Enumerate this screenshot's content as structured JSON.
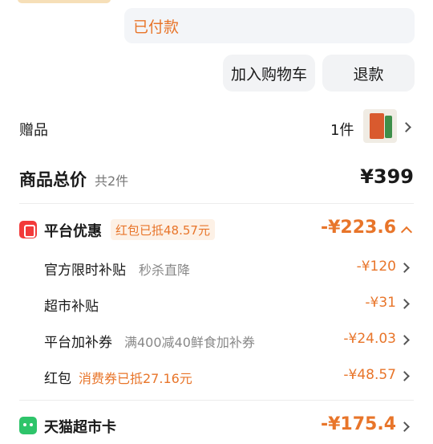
{
  "order_status": {
    "label": "已付款"
  },
  "actions": {
    "add_to_cart": "加入购物车",
    "refund": "退款"
  },
  "gift": {
    "label": "赠品",
    "quantity": "1件"
  },
  "total": {
    "label": "商品总价",
    "count": "共2件",
    "price": "¥399"
  },
  "platform_discount": {
    "title": "平台优惠",
    "badge": "红包已抵48.57元",
    "amount": "-¥223.6",
    "items": [
      {
        "label": "官方限时补贴",
        "tag": "秒杀直降",
        "amount": "-¥120"
      },
      {
        "label": "超市补贴",
        "tag": "",
        "amount": "-¥31"
      },
      {
        "label": "平台加补券",
        "tag": "满400减40鲜食加补券",
        "amount": "-¥24.03"
      },
      {
        "label": "红包",
        "tag": "消费券已抵27.16元",
        "amount": "-¥48.57"
      }
    ]
  },
  "tmall_card": {
    "title": "天猫超市卡",
    "amount": "-¥175.4"
  },
  "colors": {
    "accent": "#e8752a",
    "red_icon": "#f23a3a",
    "green_icon": "#2ec46a"
  }
}
